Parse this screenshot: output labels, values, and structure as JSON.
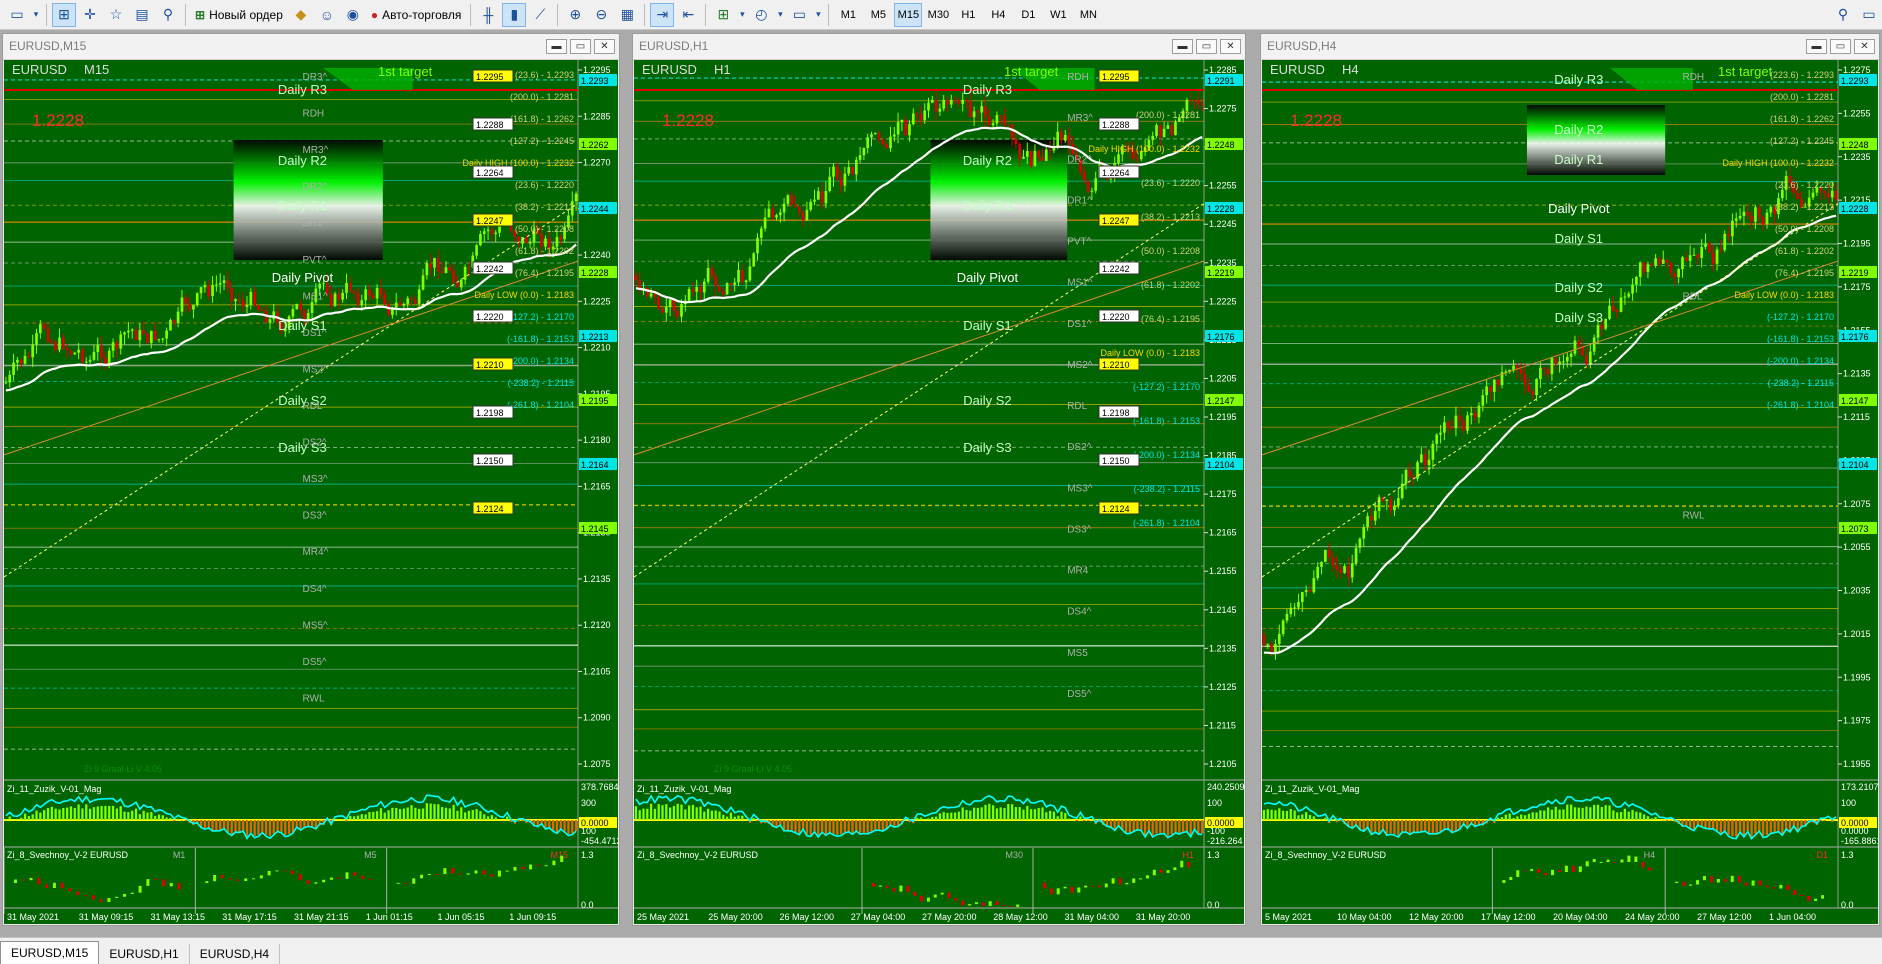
{
  "toolbar": {
    "new_order": "Новый ордер",
    "auto_trading": "Авто-торговля",
    "timeframes": [
      "M1",
      "M5",
      "M15",
      "M30",
      "H1",
      "H4",
      "D1",
      "W1",
      "MN"
    ],
    "active_timeframe": "M15"
  },
  "windows": [
    {
      "title": "EURUSD,M15",
      "symbol_label": "EURUSD",
      "tf_label": "M15",
      "big_price": "1.2228",
      "target_label": "1st target",
      "indicator_label": "Zi 9 Graal-Li V 4.05",
      "osc1_label": "Zi_11_Zuzik_V-01_Mag",
      "osc1_scale_top": "378.7684",
      "osc1_scale_a": "300",
      "osc1_scale_b": "100",
      "osc1_current": "0.0000",
      "osc1_scale_bottom": "-454.4712",
      "osc2_label": "Zi_8_Svechnoy_V-2 EURUSD",
      "osc2_scale_top": "1.3",
      "osc2_scale_bottom": "0.0",
      "osc2_tfs": [
        "M1",
        "M5",
        "M15"
      ],
      "dates": [
        "31 May 2021",
        "31 May 09:15",
        "31 May 13:15",
        "31 May 17:15",
        "31 May 21:15",
        "1 Jun 01:15",
        "1 Jun 05:15",
        "1 Jun 09:15"
      ],
      "axis": [
        "1.2295",
        "1.2285",
        "1.2270",
        "1.2255",
        "1.2240",
        "1.2225",
        "1.2210",
        "1.2195",
        "1.2180",
        "1.2165",
        "1.2150",
        "1.2135",
        "1.2120",
        "1.2105",
        "1.2090",
        "1.2075"
      ],
      "levels": [
        "DR3^",
        "RDH",
        "MR3^",
        "DR2^",
        "DR1^",
        "PVT^",
        "MS1^",
        "DS1^",
        "MS2^",
        "RDL",
        "DS2^",
        "MS3^",
        "DS3^",
        "MR4^",
        "DS4^",
        "MS5^",
        "DS5^",
        "RWL"
      ],
      "zones": [
        "Daily R3",
        "Daily R2",
        "Daily R1",
        "Daily Pivot",
        "Daily S1",
        "Daily S2",
        "Daily S3"
      ],
      "fibo": [
        "(23.6) - 1.2293",
        "(200.0) - 1.2281",
        "(161.8) - 1.2262",
        "(127.2) - 1.2245",
        "Daily HIGH (100.0) - 1.2232",
        "(23.6) - 1.2220",
        "(38.2) - 1.2213",
        "(50.0) - 1.2208",
        "(61.8) - 1.2202",
        "(76.4) - 1.2195",
        "Daily LOW (0.0) - 1.2183",
        "(-127.2) - 1.2170",
        "(-161.8) - 1.2153",
        "(-200.0) - 1.2134",
        "(-238.2) - 1.2115",
        "(-261.8) - 1.2104"
      ],
      "boxes": [
        "1.2295",
        "1.2288",
        "1.2264",
        "1.2247",
        "1.2242",
        "1.2220",
        "1.2210",
        "1.2198",
        "1.2150",
        "1.2124"
      ],
      "right_boxes": [
        "1.2293",
        "1.2262",
        "1.2244",
        "1.2228",
        "1.2213",
        "1.2195",
        "1.2164",
        "1.2145"
      ]
    },
    {
      "title": "EURUSD,H1",
      "symbol_label": "EURUSD",
      "tf_label": "H1",
      "big_price": "1.2228",
      "target_label": "1st target",
      "indicator_label": "Zi 9 Graal-Li V 4.05",
      "osc1_label": "Zi_11_Zuzik_V-01_Mag",
      "osc1_scale_top": "240.2509",
      "osc1_scale_a": "100",
      "osc1_scale_b": "-100",
      "osc1_current": "0.0000",
      "osc1_scale_bottom": "-216.264",
      "osc2_label": "Zi_8_Svechnoy_V-2 EURUSD",
      "osc2_scale_top": "1.3",
      "osc2_scale_bottom": "0.0",
      "osc2_tfs": [
        "M30",
        "H1"
      ],
      "dates": [
        "25 May 2021",
        "25 May 20:00",
        "26 May 12:00",
        "27 May 04:00",
        "27 May 20:00",
        "28 May 12:00",
        "31 May 04:00",
        "31 May 20:00"
      ],
      "axis": [
        "1.2285",
        "1.2275",
        "1.2265",
        "1.2255",
        "1.2245",
        "1.2235",
        "1.2225",
        "1.2215",
        "1.2205",
        "1.2195",
        "1.2185",
        "1.2175",
        "1.2165",
        "1.2155",
        "1.2145",
        "1.2135",
        "1.2125",
        "1.2115",
        "1.2105"
      ],
      "levels": [
        "RDH",
        "MR3^",
        "DR2^",
        "DR1^",
        "PVT^",
        "MS1^",
        "DS1^",
        "MS2^",
        "RDL",
        "DS2^",
        "MS3^",
        "DS3^",
        "MR4",
        "DS4^",
        "MS5",
        "DS5^"
      ],
      "zones": [
        "Daily R3",
        "Daily R2",
        "Daily R1",
        "Daily Pivot",
        "Daily S1",
        "Daily S2",
        "Daily S3"
      ],
      "fibo": [
        "(200.0) - 1.2281",
        "Daily HIGH (100.0) - 1.2232",
        "(23.6) - 1.2220",
        "(38.2) - 1.2213",
        "(50.0) - 1.2208",
        "(61.8) - 1.2202",
        "(76.4) - 1.2195",
        "Daily LOW (0.0) - 1.2183",
        "(-127.2) - 1.2170",
        "(-161.8) - 1.2153",
        "(-200.0) - 1.2134",
        "(-238.2) - 1.2115",
        "(-261.8) - 1.2104"
      ],
      "boxes": [
        "1.2295",
        "1.2288",
        "1.2264",
        "1.2247",
        "1.2242",
        "1.2220",
        "1.2210",
        "1.2198",
        "1.2150",
        "1.2124"
      ],
      "right_boxes": [
        "1.2291",
        "1.2248",
        "1.2228",
        "1.2219",
        "1.2176",
        "1.2147",
        "1.2104"
      ]
    },
    {
      "title": "EURUSD,H4",
      "symbol_label": "EURUSD",
      "tf_label": "H4",
      "big_price": "1.2228",
      "target_label": "1st target",
      "indicator_label": "",
      "osc1_label": "Zi_11_Zuzik_V-01_Mag",
      "osc1_scale_top": "173.2107",
      "osc1_scale_a": "100",
      "osc1_scale_b": "0.0000",
      "osc1_current": "0.0000",
      "osc1_scale_bottom": "-165.8861",
      "osc2_label": "Zi_8_Svechnoy_V-2 EURUSD",
      "osc2_scale_top": "1.3",
      "osc2_scale_bottom": "0.0",
      "osc2_tfs": [
        "H4",
        "D1"
      ],
      "dates": [
        "5 May 2021",
        "10 May 04:00",
        "12 May 20:00",
        "17 May 12:00",
        "20 May 04:00",
        "24 May 20:00",
        "27 May 12:00",
        "1 Jun 04:00"
      ],
      "axis": [
        "1.2275",
        "1.2255",
        "1.2235",
        "1.2215",
        "1.2195",
        "1.2175",
        "1.2155",
        "1.2135",
        "1.2115",
        "1.2095",
        "1.2075",
        "1.2055",
        "1.2035",
        "1.2015",
        "1.1995",
        "1.1975",
        "1.1955"
      ],
      "levels": [
        "RDH",
        "RDL",
        "RWL"
      ],
      "zones": [
        "Daily R3",
        "Daily R2",
        "Daily R1",
        "Daily Pivot",
        "Daily S1",
        "Daily S2",
        "Daily S3"
      ],
      "fibo": [
        "(223.6) - 1.2293",
        "(200.0) - 1.2281",
        "(161.8) - 1.2262",
        "(127.2) - 1.2245",
        "Daily HIGH (100.0) - 1.2232",
        "(23.6) - 1.2220",
        "(38.2) - 1.2213",
        "(50.0) - 1.2208",
        "(61.8) - 1.2202",
        "(76.4) - 1.2195",
        "Daily LOW (0.0) - 1.2183",
        "(-127.2) - 1.2170",
        "(-161.8) - 1.2153",
        "(-200.0) - 1.2134",
        "(-238.2) - 1.2115",
        "(-261.8) - 1.2104"
      ],
      "boxes": [],
      "right_boxes": [
        "1.2293",
        "1.2248",
        "1.2228",
        "1.2219",
        "1.2176",
        "1.2147",
        "1.2104",
        "1.2073"
      ]
    }
  ],
  "tabs": [
    "EURUSD,M15",
    "EURUSD,H1",
    "EURUSD,H4"
  ],
  "active_tab": 0,
  "colors": {
    "chart_bg": "#006400",
    "bull": "#7fff00",
    "bear": "#e00000",
    "level_cyan": "#00e5e5",
    "level_yellow": "#ffd700",
    "text_gray": "#a9a9a9"
  }
}
